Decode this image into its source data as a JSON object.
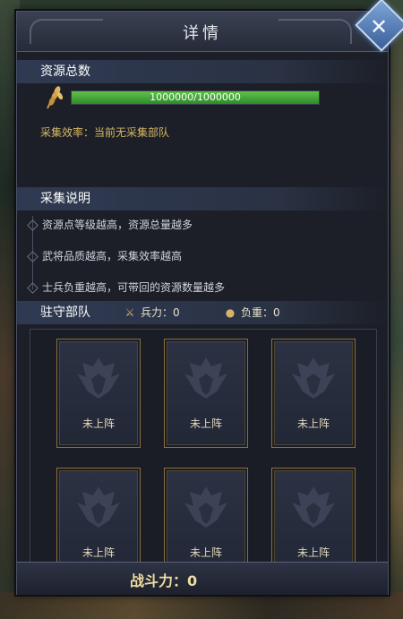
{
  "dialog": {
    "title": "详情",
    "close_symbol": "✕"
  },
  "resource": {
    "header": "资源总数",
    "icon": "wheat-icon",
    "current": 1000000,
    "max": 1000000,
    "fill_fraction": 1.0,
    "bar_text": "1000000/1000000",
    "efficiency_text": "采集效率：当前无采集部队"
  },
  "collection": {
    "header": "采集说明",
    "tips": [
      "资源点等级越高，资源总量越多",
      "武将品质越高，采集效率越高",
      "士兵负重越高，可带回的资源数量越多"
    ]
  },
  "garrison": {
    "header": "驻守部队",
    "troops_label": "兵力：0",
    "load_label": "负重：0",
    "slots": [
      "未上阵",
      "未上阵",
      "未上阵",
      "未上阵",
      "未上阵",
      "未上阵"
    ]
  },
  "power": {
    "label": "战斗力：0"
  },
  "colors": {
    "bar_fill": "#4fb03d",
    "accent_gold": "#d7b865",
    "panel": "#1c1f27"
  }
}
